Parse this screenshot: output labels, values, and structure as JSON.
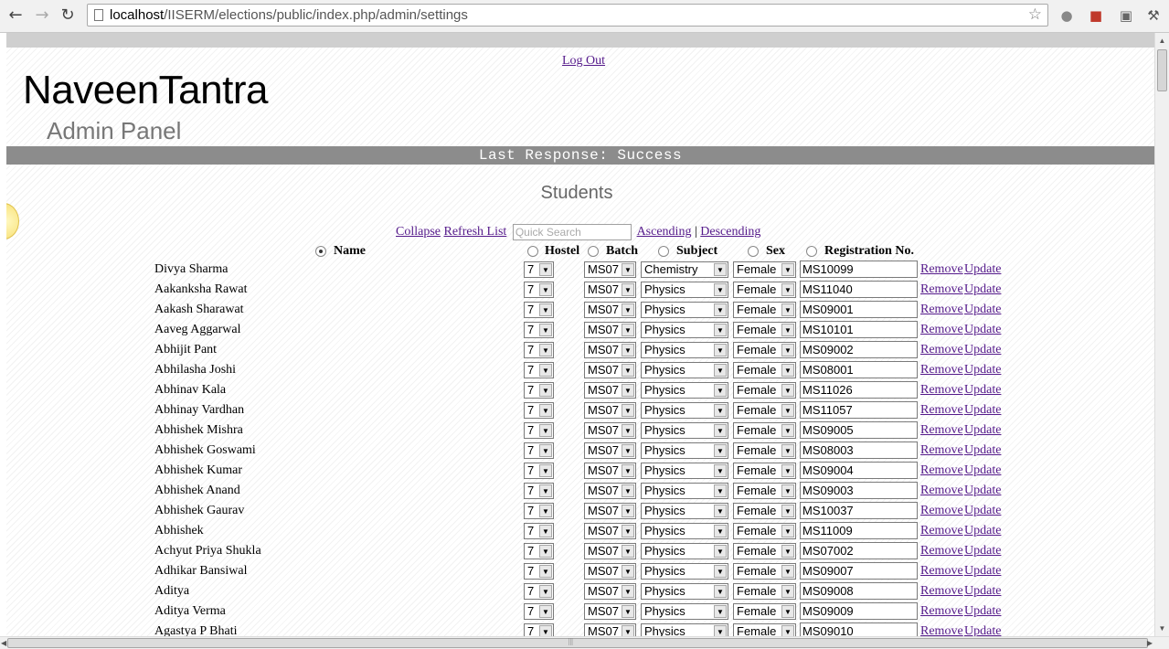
{
  "browser": {
    "url_host": "localhost",
    "url_path": "/IISERM/elections/public/index.php/admin/settings",
    "back_icon": "back-arrow-icon",
    "forward_icon": "forward-arrow-icon",
    "reload_icon": "reload-icon"
  },
  "header": {
    "logout_label": "Log Out",
    "brand": "NaveenTantra",
    "subtitle": "Admin Panel",
    "status": "Last Response: Success"
  },
  "section": {
    "title": "Students",
    "collapse_label": "Collapse",
    "refresh_label": "Refresh List",
    "search_placeholder": "Quick Search",
    "ascending_label": "Ascending",
    "separator": "|",
    "descending_label": "Descending"
  },
  "sort_fields": [
    {
      "label": "Name",
      "selected": true
    },
    {
      "label": "Hostel",
      "selected": false
    },
    {
      "label": "Batch",
      "selected": false
    },
    {
      "label": "Subject",
      "selected": false
    },
    {
      "label": "Sex",
      "selected": false
    },
    {
      "label": "Registration No.",
      "selected": false
    }
  ],
  "row_actions": {
    "remove": "Remove",
    "update": "Update"
  },
  "students": [
    {
      "name": "Divya Sharma",
      "hostel": "7",
      "batch": "MS07",
      "subject": "Chemistry",
      "sex": "Female",
      "reg": "MS10099"
    },
    {
      "name": "Aakanksha Rawat",
      "hostel": "7",
      "batch": "MS07",
      "subject": "Physics",
      "sex": "Female",
      "reg": "MS11040"
    },
    {
      "name": "Aakash Sharawat",
      "hostel": "7",
      "batch": "MS07",
      "subject": "Physics",
      "sex": "Female",
      "reg": "MS09001"
    },
    {
      "name": "Aaveg Aggarwal",
      "hostel": "7",
      "batch": "MS07",
      "subject": "Physics",
      "sex": "Female",
      "reg": "MS10101"
    },
    {
      "name": "Abhijit Pant",
      "hostel": "7",
      "batch": "MS07",
      "subject": "Physics",
      "sex": "Female",
      "reg": "MS09002"
    },
    {
      "name": "Abhilasha Joshi",
      "hostel": "7",
      "batch": "MS07",
      "subject": "Physics",
      "sex": "Female",
      "reg": "MS08001"
    },
    {
      "name": "Abhinav Kala",
      "hostel": "7",
      "batch": "MS07",
      "subject": "Physics",
      "sex": "Female",
      "reg": "MS11026"
    },
    {
      "name": "Abhinay Vardhan",
      "hostel": "7",
      "batch": "MS07",
      "subject": "Physics",
      "sex": "Female",
      "reg": "MS11057"
    },
    {
      "name": "Abhishek Mishra",
      "hostel": "7",
      "batch": "MS07",
      "subject": "Physics",
      "sex": "Female",
      "reg": "MS09005"
    },
    {
      "name": "Abhishek Goswami",
      "hostel": "7",
      "batch": "MS07",
      "subject": "Physics",
      "sex": "Female",
      "reg": "MS08003"
    },
    {
      "name": "Abhishek Kumar",
      "hostel": "7",
      "batch": "MS07",
      "subject": "Physics",
      "sex": "Female",
      "reg": "MS09004"
    },
    {
      "name": "Abhishek Anand",
      "hostel": "7",
      "batch": "MS07",
      "subject": "Physics",
      "sex": "Female",
      "reg": "MS09003"
    },
    {
      "name": "Abhishek Gaurav",
      "hostel": "7",
      "batch": "MS07",
      "subject": "Physics",
      "sex": "Female",
      "reg": "MS10037"
    },
    {
      "name": "Abhishek",
      "hostel": "7",
      "batch": "MS07",
      "subject": "Physics",
      "sex": "Female",
      "reg": "MS11009"
    },
    {
      "name": "Achyut Priya Shukla",
      "hostel": "7",
      "batch": "MS07",
      "subject": "Physics",
      "sex": "Female",
      "reg": "MS07002"
    },
    {
      "name": "Adhikar Bansiwal",
      "hostel": "7",
      "batch": "MS07",
      "subject": "Physics",
      "sex": "Female",
      "reg": "MS09007"
    },
    {
      "name": "Aditya",
      "hostel": "7",
      "batch": "MS07",
      "subject": "Physics",
      "sex": "Female",
      "reg": "MS09008"
    },
    {
      "name": "Aditya Verma",
      "hostel": "7",
      "batch": "MS07",
      "subject": "Physics",
      "sex": "Female",
      "reg": "MS09009"
    },
    {
      "name": "Agastya P Bhati",
      "hostel": "7",
      "batch": "MS07",
      "subject": "Physics",
      "sex": "Female",
      "reg": "MS09010"
    }
  ]
}
